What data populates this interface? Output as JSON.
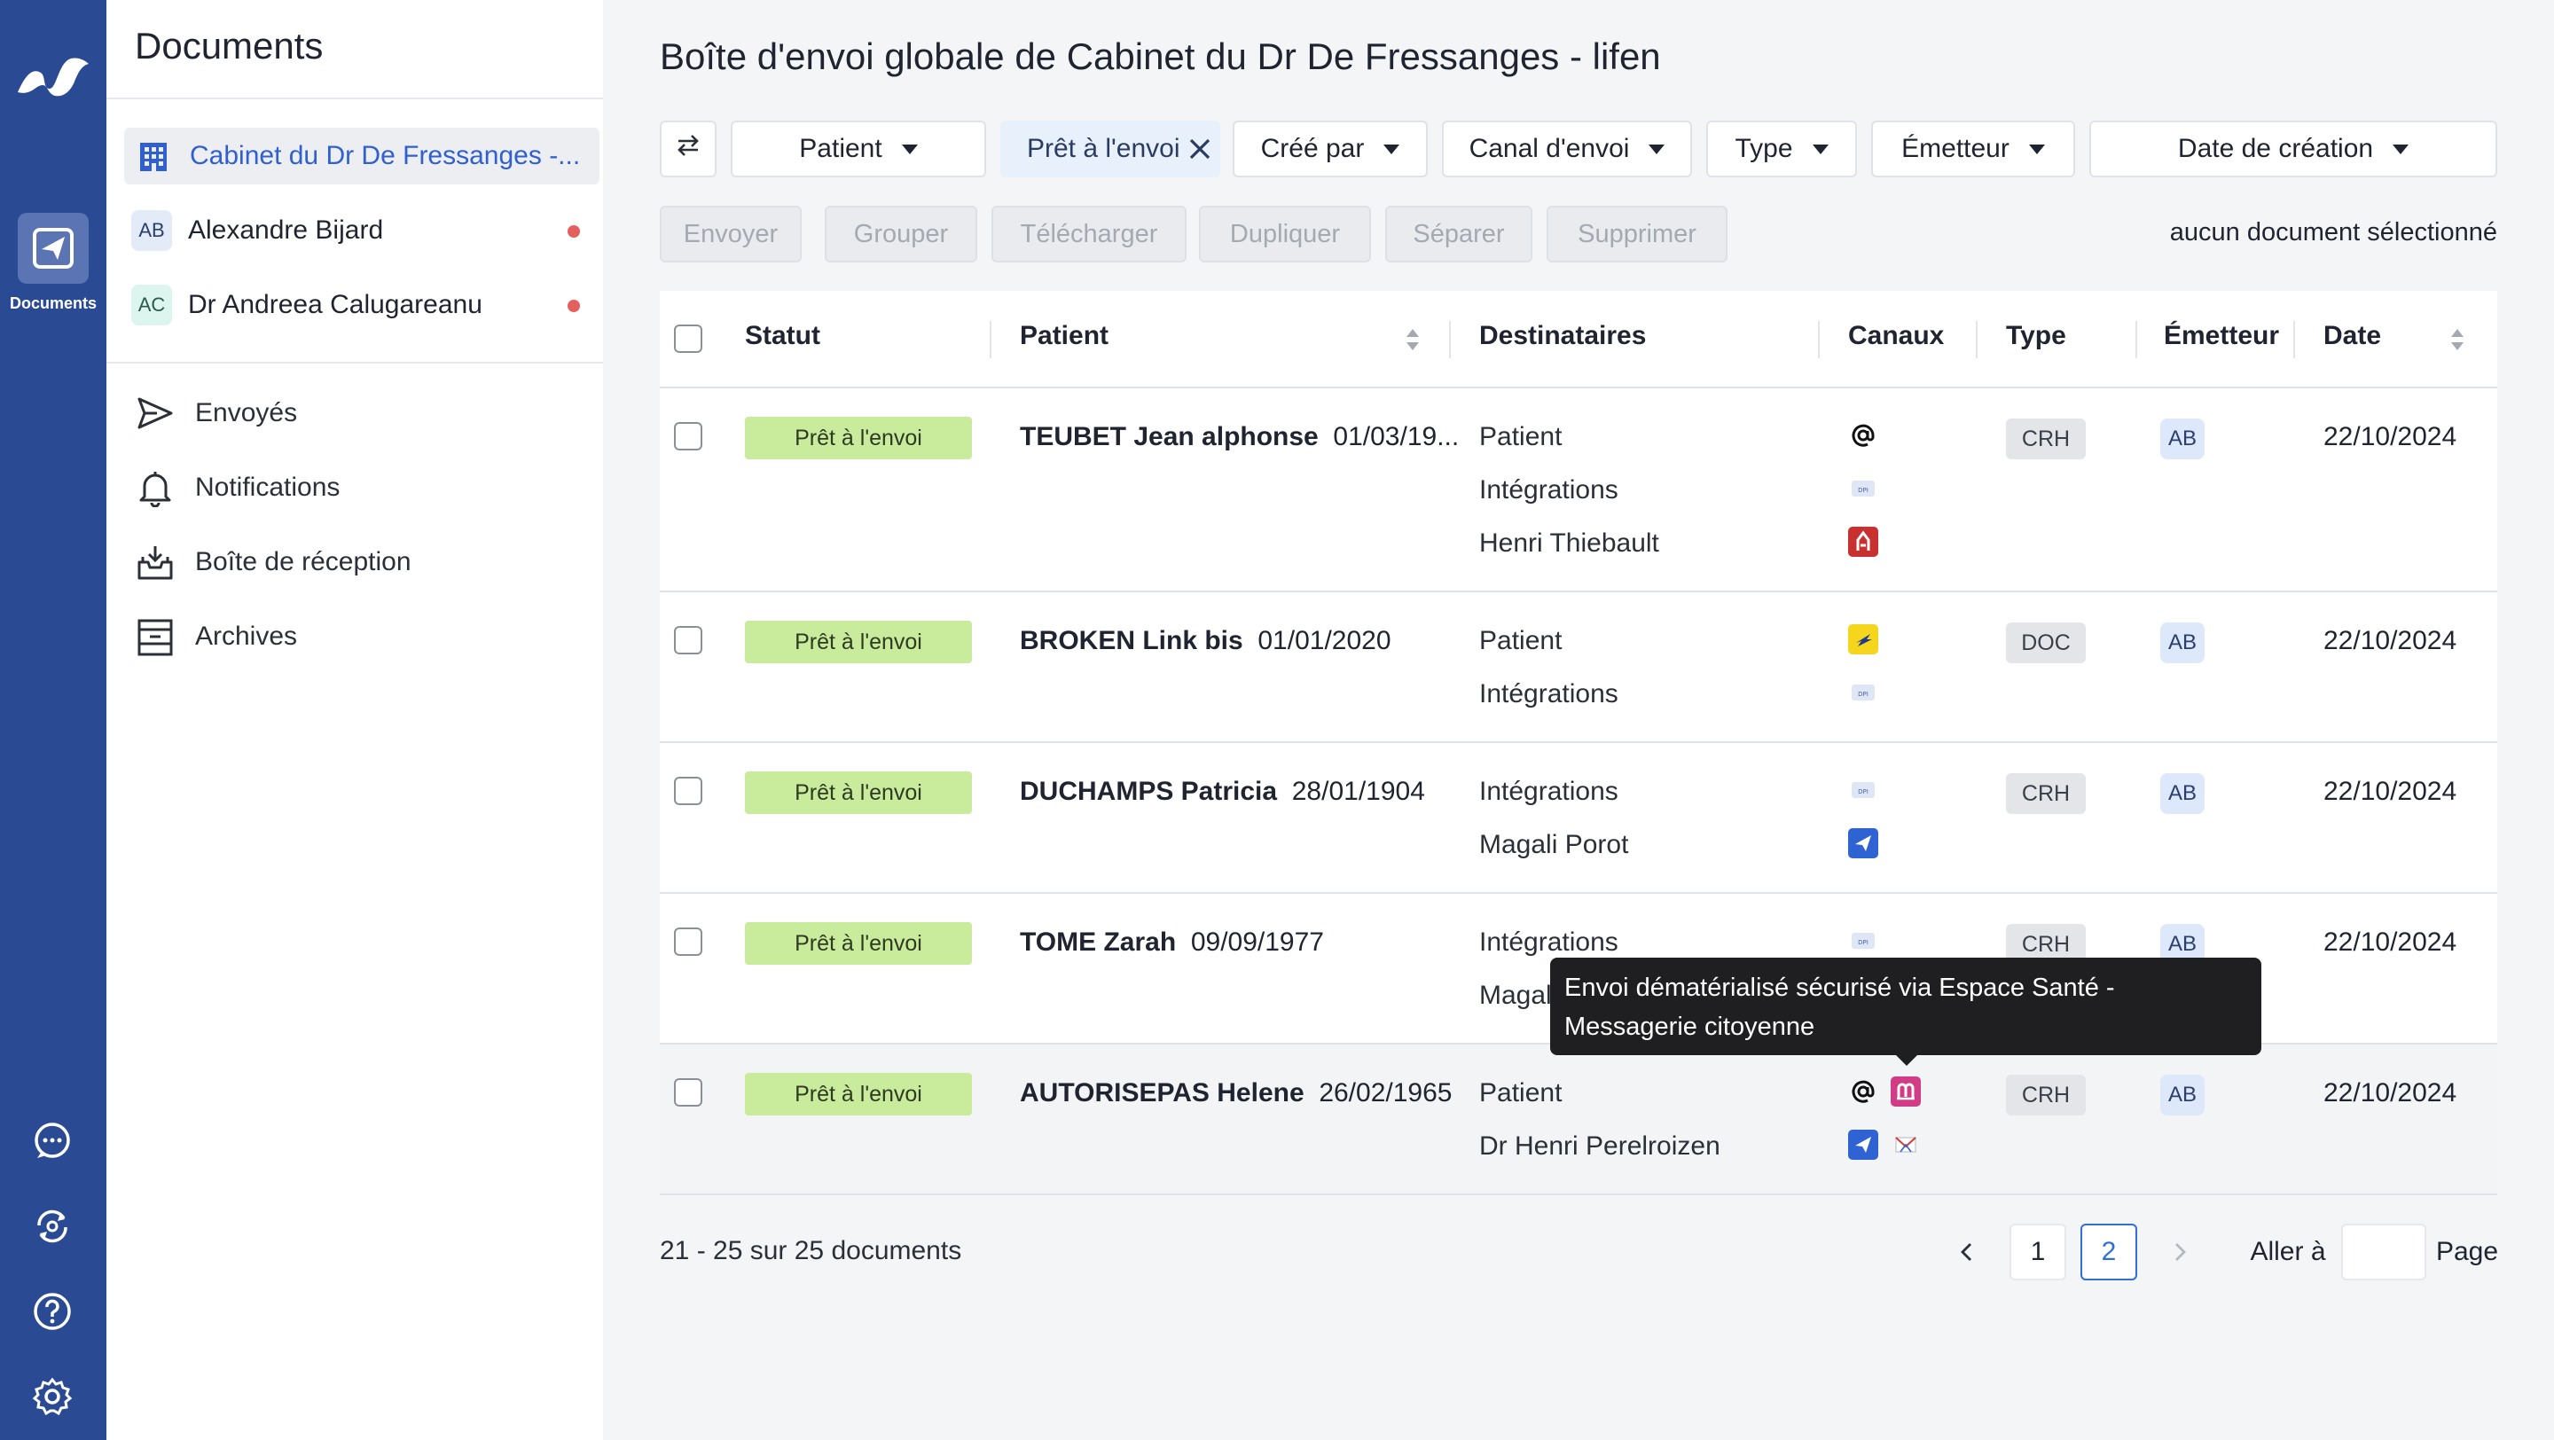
{
  "rail": {
    "documents_label": "Documents"
  },
  "sidebar": {
    "title": "Documents",
    "accounts": [
      {
        "label": "Cabinet du Dr De Fressanges -...",
        "avatar": ""
      },
      {
        "label": "Alexandre Bijard",
        "avatar": "AB"
      },
      {
        "label": "Dr Andreea Calugareanu",
        "avatar": "AC"
      }
    ],
    "nav": [
      {
        "label": "Envoyés",
        "icon": "send-icon"
      },
      {
        "label": "Notifications",
        "icon": "bell-icon"
      },
      {
        "label": "Boîte de réception",
        "icon": "inbox-icon"
      },
      {
        "label": "Archives",
        "icon": "archive-icon"
      }
    ]
  },
  "main": {
    "title": "Boîte d'envoi globale de Cabinet du Dr De Fressanges - lifen",
    "filters": {
      "patient": "Patient",
      "active_chip": "Prêt à l'envoi",
      "created_by": "Créé par",
      "channel": "Canal d'envoi",
      "type": "Type",
      "sender": "Émetteur",
      "date": "Date de création"
    },
    "actions": [
      "Envoyer",
      "Grouper",
      "Télécharger",
      "Dupliquer",
      "Séparer",
      "Supprimer"
    ],
    "selection_info": "aucun document sélectionné",
    "columns": [
      "Statut",
      "Patient",
      "Destinataires",
      "Canaux",
      "Type",
      "Émetteur",
      "Date"
    ],
    "rows": [
      {
        "status": "Prêt à l'envoi",
        "patient_name": "TEUBET Jean alphonse",
        "patient_dob": "01/03/19...",
        "recipients": [
          "Patient",
          "Intégrations",
          "Henri Thiebault"
        ],
        "type": "CRH",
        "sender": "AB",
        "date": "22/10/2024"
      },
      {
        "status": "Prêt à l'envoi",
        "patient_name": "BROKEN Link bis",
        "patient_dob": "01/01/2020",
        "recipients": [
          "Patient",
          "Intégrations"
        ],
        "type": "DOC",
        "sender": "AB",
        "date": "22/10/2024"
      },
      {
        "status": "Prêt à l'envoi",
        "patient_name": "DUCHAMPS Patricia",
        "patient_dob": "28/01/1904",
        "recipients": [
          "Intégrations",
          "Magali Porot"
        ],
        "type": "CRH",
        "sender": "AB",
        "date": "22/10/2024"
      },
      {
        "status": "Prêt à l'envoi",
        "patient_name": "TOME Zarah",
        "patient_dob": "09/09/1977",
        "recipients": [
          "Intégrations",
          "Magal"
        ],
        "type": "CRH",
        "sender": "AB",
        "date": "22/10/2024"
      },
      {
        "status": "Prêt à l'envoi",
        "patient_name": "AUTORISEPAS Helene",
        "patient_dob": "26/02/1965",
        "recipients": [
          "Patient",
          "Dr Henri Perelroizen"
        ],
        "type": "CRH",
        "sender": "AB",
        "date": "22/10/2024"
      }
    ],
    "tooltip": "Envoi dématérialisé sécurisé via Espace Santé - Messagerie citoyenne",
    "pagination": {
      "count": "21 - 25 sur 25 documents",
      "pages": [
        "1",
        "2"
      ],
      "goto_label": "Aller à",
      "page_label": "Page",
      "goto_value": ""
    }
  }
}
